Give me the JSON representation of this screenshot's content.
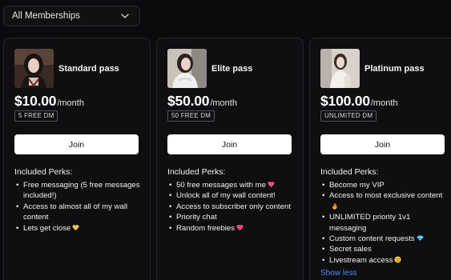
{
  "filter": {
    "selected": "All Memberships"
  },
  "cards": [
    {
      "name": "Standard pass",
      "price": "$10.00",
      "period": "/month",
      "badge": "5 FREE DM",
      "join_label": "Join",
      "perks_title": "Included Perks:",
      "perks": [
        {
          "text": "Free messaging (5 free messages included!)",
          "emoji": ""
        },
        {
          "text": "Access to almost all of my wall content",
          "emoji": ""
        },
        {
          "text": "Lets get close",
          "emoji": "yellow-heart-icon"
        }
      ]
    },
    {
      "name": "Elite pass",
      "price": "$50.00",
      "period": "/month",
      "badge": "50 FREE DM",
      "join_label": "Join",
      "perks_title": "Included Perks:",
      "perks": [
        {
          "text": "50 free messages with me",
          "emoji": "pink-heart-icon"
        },
        {
          "text": "Unlock all of my wall content!",
          "emoji": ""
        },
        {
          "text": "Access to subscriber only content",
          "emoji": ""
        },
        {
          "text": "Priority chat",
          "emoji": ""
        },
        {
          "text": "Random freebies",
          "emoji": "pink-heart-icon"
        }
      ]
    },
    {
      "name": "Platinum pass",
      "price": "$100.00",
      "period": "/month",
      "badge": "UNLIMITED DM",
      "join_label": "Join",
      "perks_title": "Included Perks:",
      "perks": [
        {
          "text": "Become my VIP",
          "emoji": ""
        },
        {
          "text": "Access to most exclusive content",
          "emoji": "fire-icon"
        },
        {
          "text": "UNLIMITED priority 1v1 messaging",
          "emoji": ""
        },
        {
          "text": "Custom content requests",
          "emoji": "diamond-icon"
        },
        {
          "text": "Secret sales",
          "emoji": ""
        },
        {
          "text": "Livestream access",
          "emoji": "smirk-face-icon"
        }
      ],
      "toggle_label": "Show less"
    }
  ],
  "colors": {
    "background": "#0b0b0d",
    "card": "#0f0f12",
    "link": "#4a8df5",
    "button": "#ffffff"
  }
}
